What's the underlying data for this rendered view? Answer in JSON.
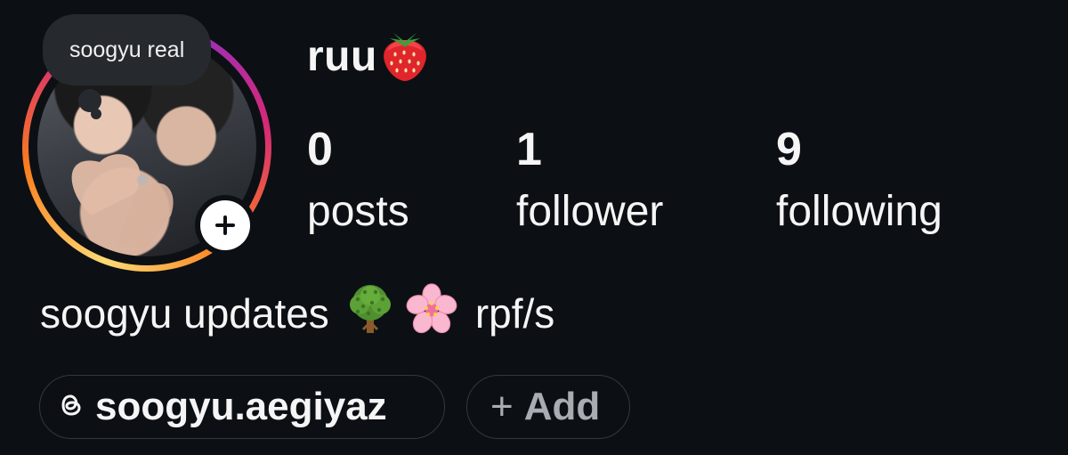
{
  "profile": {
    "username": "ruu",
    "username_emoji": "strawberry-emoji",
    "note_text": "soogyu real",
    "stats": {
      "posts_count": "0",
      "posts_label": "posts",
      "followers_count": "1",
      "followers_label": "follower",
      "following_count": "9",
      "following_label": "following"
    },
    "bio": {
      "text_before": "soogyu updates",
      "emoji_1": "tree-emoji",
      "emoji_2": "cherry-blossom-emoji",
      "text_after": "rpf/s"
    },
    "links": {
      "threads_handle": "soogyu.aegiyaz",
      "add_plus": "+",
      "add_label": "Add"
    }
  },
  "colors": {
    "background": "#0c1014",
    "text": "#f5f5f5",
    "muted": "#a8adb3",
    "bubble": "#262a2f",
    "chip_border": "#33383e"
  }
}
